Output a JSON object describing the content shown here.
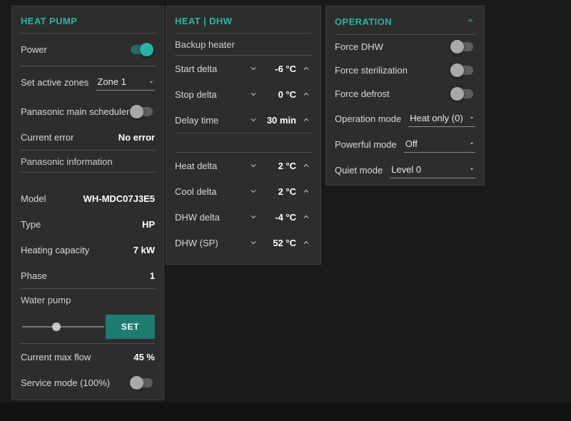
{
  "colors": {
    "accent": "#2ab3a3",
    "set_button": "#1e7b72",
    "panel_background": "#2d2d2d",
    "page_background": "#1a1a1a"
  },
  "heat_pump": {
    "title": "HEAT PUMP",
    "power": {
      "label": "Power",
      "on": true
    },
    "zones": {
      "label": "Set active zones",
      "value": "Zone 1"
    },
    "scheduler": {
      "label": "Panasonic main scheduler",
      "on": false
    },
    "error": {
      "label": "Current error",
      "value": "No error"
    },
    "info_header": "Panasonic information",
    "info": [
      {
        "label": "Model",
        "value": "WH-MDC07J3E5"
      },
      {
        "label": "Type",
        "value": "HP"
      },
      {
        "label": "Heating capacity",
        "value": "7 kW"
      },
      {
        "label": "Phase",
        "value": "1"
      }
    ],
    "water_pump": {
      "label": "Water pump",
      "set_label": "SET",
      "slider_percent": 42
    },
    "max_flow": {
      "label": "Current max flow",
      "value": "45 %"
    },
    "service_mode": {
      "label": "Service mode (100%)",
      "on": false
    }
  },
  "heat_dhw": {
    "title": "HEAT | DHW",
    "backup_header": "Backup heater",
    "top_steppers": [
      {
        "label": "Start delta",
        "value": "-6 °C"
      },
      {
        "label": "Stop delta",
        "value": "0 °C"
      },
      {
        "label": "Delay time",
        "value": "30 min"
      }
    ],
    "bottom_steppers": [
      {
        "label": "Heat delta",
        "value": "2 °C"
      },
      {
        "label": "Cool delta",
        "value": "2 °C"
      },
      {
        "label": "DHW delta",
        "value": "-4 °C"
      },
      {
        "label": "DHW (SP)",
        "value": "52 °C"
      }
    ]
  },
  "operation": {
    "title": "OPERATION",
    "toggles": [
      {
        "label": "Force DHW",
        "on": false
      },
      {
        "label": "Force sterilization",
        "on": false
      },
      {
        "label": "Force defrost",
        "on": false
      }
    ],
    "dropdowns": [
      {
        "label": "Operation mode",
        "value": "Heat only (0)"
      },
      {
        "label": "Powerful mode",
        "value": "Off"
      },
      {
        "label": "Quiet mode",
        "value": "Level 0"
      }
    ]
  }
}
